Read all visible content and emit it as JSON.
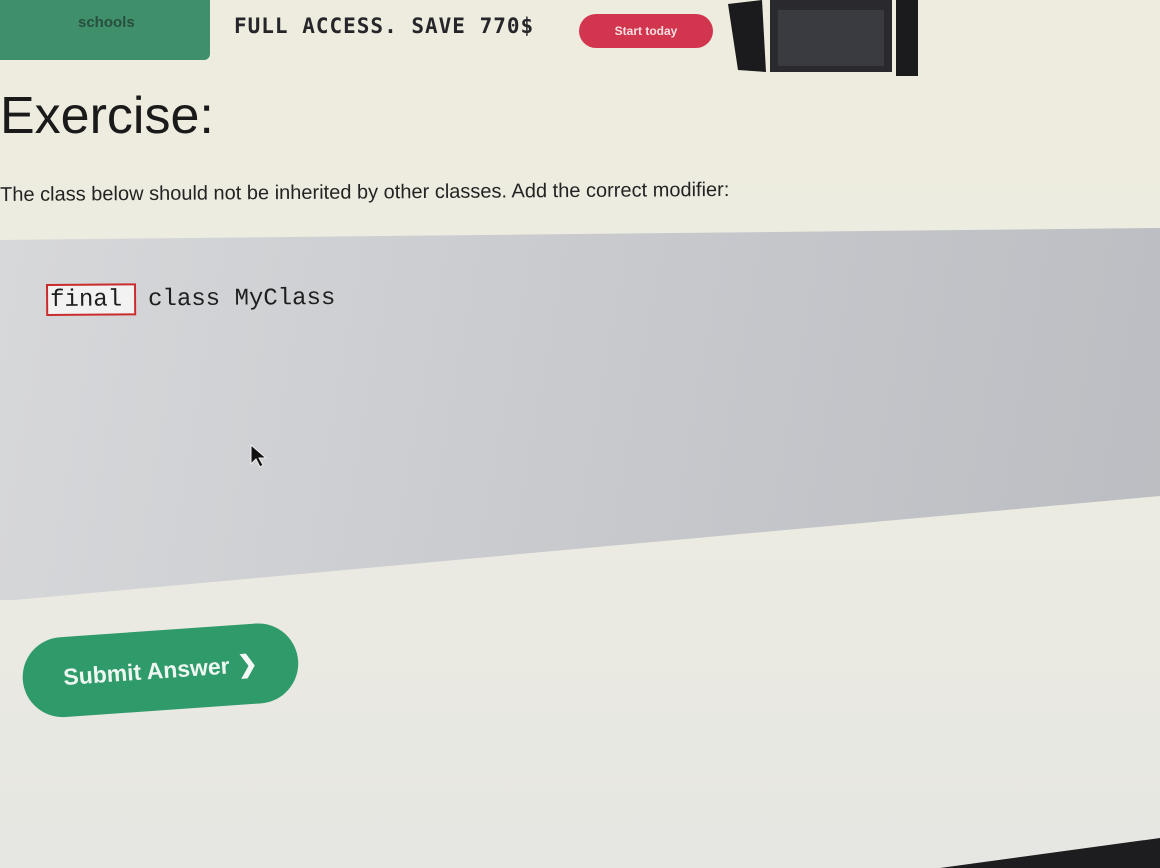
{
  "banner": {
    "logo": "schools",
    "headline": "FULL ACCESS. SAVE 770$",
    "cta_label": "Start today",
    "colors": {
      "logo_bg": "#3f8f6a",
      "cta_bg": "#d2364f"
    }
  },
  "exercise": {
    "title": "Exercise:",
    "instruction": "The class below should not be inherited by other classes. Add the correct modifier:",
    "answer_value": "final",
    "code_rest": "class MyClass",
    "input_border_color": "#c92b2b"
  },
  "submit": {
    "label": "Submit Answer",
    "icon": "chevron-right-icon",
    "color": "#2f9a6a"
  }
}
